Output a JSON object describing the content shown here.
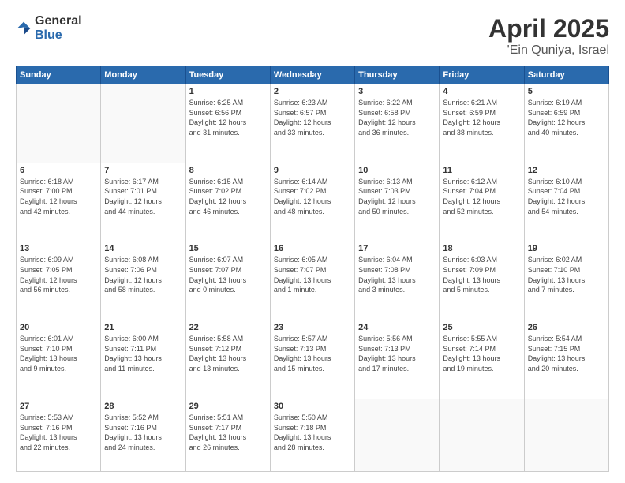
{
  "logo": {
    "general": "General",
    "blue": "Blue"
  },
  "title": {
    "month": "April 2025",
    "location": "'Ein Quniya, Israel"
  },
  "weekdays": [
    "Sunday",
    "Monday",
    "Tuesday",
    "Wednesday",
    "Thursday",
    "Friday",
    "Saturday"
  ],
  "weeks": [
    [
      {
        "day": "",
        "info": ""
      },
      {
        "day": "",
        "info": ""
      },
      {
        "day": "1",
        "info": "Sunrise: 6:25 AM\nSunset: 6:56 PM\nDaylight: 12 hours\nand 31 minutes."
      },
      {
        "day": "2",
        "info": "Sunrise: 6:23 AM\nSunset: 6:57 PM\nDaylight: 12 hours\nand 33 minutes."
      },
      {
        "day": "3",
        "info": "Sunrise: 6:22 AM\nSunset: 6:58 PM\nDaylight: 12 hours\nand 36 minutes."
      },
      {
        "day": "4",
        "info": "Sunrise: 6:21 AM\nSunset: 6:59 PM\nDaylight: 12 hours\nand 38 minutes."
      },
      {
        "day": "5",
        "info": "Sunrise: 6:19 AM\nSunset: 6:59 PM\nDaylight: 12 hours\nand 40 minutes."
      }
    ],
    [
      {
        "day": "6",
        "info": "Sunrise: 6:18 AM\nSunset: 7:00 PM\nDaylight: 12 hours\nand 42 minutes."
      },
      {
        "day": "7",
        "info": "Sunrise: 6:17 AM\nSunset: 7:01 PM\nDaylight: 12 hours\nand 44 minutes."
      },
      {
        "day": "8",
        "info": "Sunrise: 6:15 AM\nSunset: 7:02 PM\nDaylight: 12 hours\nand 46 minutes."
      },
      {
        "day": "9",
        "info": "Sunrise: 6:14 AM\nSunset: 7:02 PM\nDaylight: 12 hours\nand 48 minutes."
      },
      {
        "day": "10",
        "info": "Sunrise: 6:13 AM\nSunset: 7:03 PM\nDaylight: 12 hours\nand 50 minutes."
      },
      {
        "day": "11",
        "info": "Sunrise: 6:12 AM\nSunset: 7:04 PM\nDaylight: 12 hours\nand 52 minutes."
      },
      {
        "day": "12",
        "info": "Sunrise: 6:10 AM\nSunset: 7:04 PM\nDaylight: 12 hours\nand 54 minutes."
      }
    ],
    [
      {
        "day": "13",
        "info": "Sunrise: 6:09 AM\nSunset: 7:05 PM\nDaylight: 12 hours\nand 56 minutes."
      },
      {
        "day": "14",
        "info": "Sunrise: 6:08 AM\nSunset: 7:06 PM\nDaylight: 12 hours\nand 58 minutes."
      },
      {
        "day": "15",
        "info": "Sunrise: 6:07 AM\nSunset: 7:07 PM\nDaylight: 13 hours\nand 0 minutes."
      },
      {
        "day": "16",
        "info": "Sunrise: 6:05 AM\nSunset: 7:07 PM\nDaylight: 13 hours\nand 1 minute."
      },
      {
        "day": "17",
        "info": "Sunrise: 6:04 AM\nSunset: 7:08 PM\nDaylight: 13 hours\nand 3 minutes."
      },
      {
        "day": "18",
        "info": "Sunrise: 6:03 AM\nSunset: 7:09 PM\nDaylight: 13 hours\nand 5 minutes."
      },
      {
        "day": "19",
        "info": "Sunrise: 6:02 AM\nSunset: 7:10 PM\nDaylight: 13 hours\nand 7 minutes."
      }
    ],
    [
      {
        "day": "20",
        "info": "Sunrise: 6:01 AM\nSunset: 7:10 PM\nDaylight: 13 hours\nand 9 minutes."
      },
      {
        "day": "21",
        "info": "Sunrise: 6:00 AM\nSunset: 7:11 PM\nDaylight: 13 hours\nand 11 minutes."
      },
      {
        "day": "22",
        "info": "Sunrise: 5:58 AM\nSunset: 7:12 PM\nDaylight: 13 hours\nand 13 minutes."
      },
      {
        "day": "23",
        "info": "Sunrise: 5:57 AM\nSunset: 7:13 PM\nDaylight: 13 hours\nand 15 minutes."
      },
      {
        "day": "24",
        "info": "Sunrise: 5:56 AM\nSunset: 7:13 PM\nDaylight: 13 hours\nand 17 minutes."
      },
      {
        "day": "25",
        "info": "Sunrise: 5:55 AM\nSunset: 7:14 PM\nDaylight: 13 hours\nand 19 minutes."
      },
      {
        "day": "26",
        "info": "Sunrise: 5:54 AM\nSunset: 7:15 PM\nDaylight: 13 hours\nand 20 minutes."
      }
    ],
    [
      {
        "day": "27",
        "info": "Sunrise: 5:53 AM\nSunset: 7:16 PM\nDaylight: 13 hours\nand 22 minutes."
      },
      {
        "day": "28",
        "info": "Sunrise: 5:52 AM\nSunset: 7:16 PM\nDaylight: 13 hours\nand 24 minutes."
      },
      {
        "day": "29",
        "info": "Sunrise: 5:51 AM\nSunset: 7:17 PM\nDaylight: 13 hours\nand 26 minutes."
      },
      {
        "day": "30",
        "info": "Sunrise: 5:50 AM\nSunset: 7:18 PM\nDaylight: 13 hours\nand 28 minutes."
      },
      {
        "day": "",
        "info": ""
      },
      {
        "day": "",
        "info": ""
      },
      {
        "day": "",
        "info": ""
      }
    ]
  ]
}
